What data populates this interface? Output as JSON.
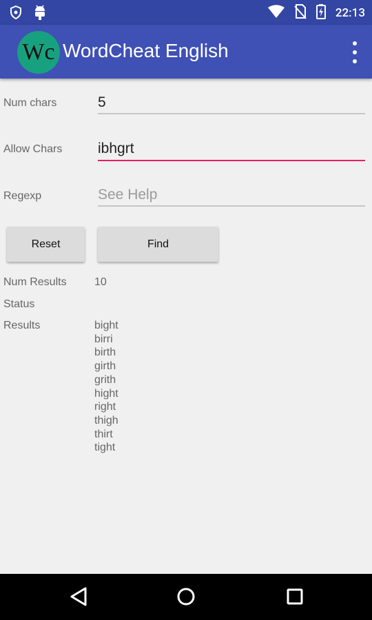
{
  "status_bar": {
    "time": "22:13",
    "icons": [
      "shield-icon",
      "android-icon",
      "wifi-icon",
      "no-sim-icon",
      "battery-icon"
    ]
  },
  "app_bar": {
    "logo_text": "Wc",
    "title": "WordCheat English",
    "menu_icon": "more-vert-icon",
    "color": "#3f51b5",
    "logo_color": "#18a17f"
  },
  "form": {
    "num_chars": {
      "label": "Num chars",
      "value": "5"
    },
    "allow_chars": {
      "label": "Allow Chars",
      "value": "ibhgrt",
      "accent": "#e91e63"
    },
    "regexp": {
      "label": "Regexp",
      "value": "",
      "placeholder": "See Help"
    }
  },
  "buttons": {
    "reset": "Reset",
    "find": "Find"
  },
  "output": {
    "num_results_label": "Num Results",
    "num_results_value": "10",
    "status_label": "Status",
    "status_value": "",
    "results_label": "Results",
    "results": [
      "bight",
      "birri",
      "birth",
      "girth",
      "grith",
      "hight",
      "right",
      "thigh",
      "thirt",
      "tight"
    ]
  },
  "nav_bar": {
    "icons": [
      "back-icon",
      "home-icon",
      "recents-icon"
    ]
  }
}
